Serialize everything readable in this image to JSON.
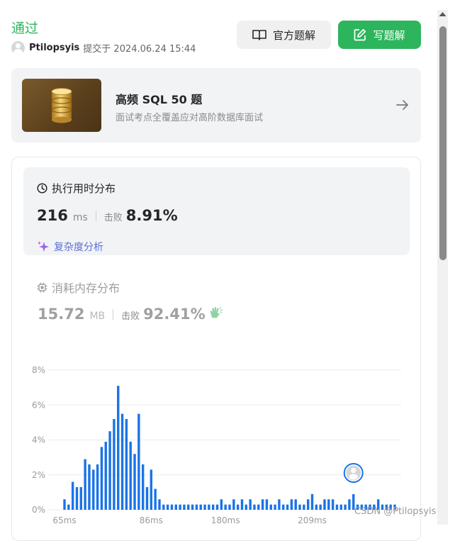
{
  "header": {
    "status": "通过",
    "username": "Ptilopsyis",
    "submitted_text": "提交于 2024.06.24 15:44",
    "official_solution_label": "官方题解",
    "write_solution_label": "写题解"
  },
  "banner": {
    "title": "高频 SQL 50 题",
    "subtitle": "面试考点全覆盖应对高阶数据库面试"
  },
  "runtime": {
    "heading": "执行用时分布",
    "value": "216",
    "unit": "ms",
    "beat_label": "击败",
    "beat_percent": "8.91%",
    "complexity_link": "复杂度分析"
  },
  "memory": {
    "heading": "消耗内存分布",
    "value": "15.72",
    "unit": "MB",
    "beat_label": "击败",
    "beat_percent": "92.41%"
  },
  "watermark": "CSDN @Ptilopsyis",
  "colors": {
    "accent_green": "#2db55d",
    "bar_blue": "#1a73e8",
    "complexity_purple": "#5b6fd8"
  },
  "chart_data": {
    "type": "bar",
    "title": "",
    "xlabel": "",
    "ylabel": "",
    "y_ticks": [
      "8%",
      "6%",
      "4%",
      "2%",
      "0%"
    ],
    "x_ticks": [
      "65ms",
      "86ms",
      "180ms",
      "209ms"
    ],
    "ylim": [
      0,
      8
    ],
    "values": [
      0.6,
      0.3,
      1.6,
      1.3,
      1.3,
      2.9,
      2.6,
      2.3,
      2.6,
      3.6,
      3.9,
      4.5,
      5.2,
      7.1,
      5.5,
      5.2,
      3.9,
      3.2,
      5.5,
      2.6,
      1.3,
      2.3,
      1.2,
      0.6,
      0.3,
      0.3,
      0.3,
      0.3,
      0.3,
      0.3,
      0.3,
      0.3,
      0.3,
      0.3,
      0.3,
      0.3,
      0.3,
      0.3,
      0.6,
      0.3,
      0.3,
      0.6,
      0.3,
      0.6,
      0.3,
      0.6,
      0.3,
      0.3,
      0.6,
      0.6,
      0.3,
      0.3,
      0.6,
      0.3,
      0.3,
      0.6,
      0.6,
      0.3,
      0.3,
      0.6,
      0.9,
      0.3,
      0.3,
      0.6,
      0.6,
      0.6,
      0.3,
      0.3,
      0.3,
      0.6,
      0.9,
      0.3,
      0.3,
      0.3,
      0.3,
      0.3,
      0.6,
      0.3,
      0.3,
      0.3,
      0.3
    ],
    "highlight_index": 70,
    "grid": true
  }
}
